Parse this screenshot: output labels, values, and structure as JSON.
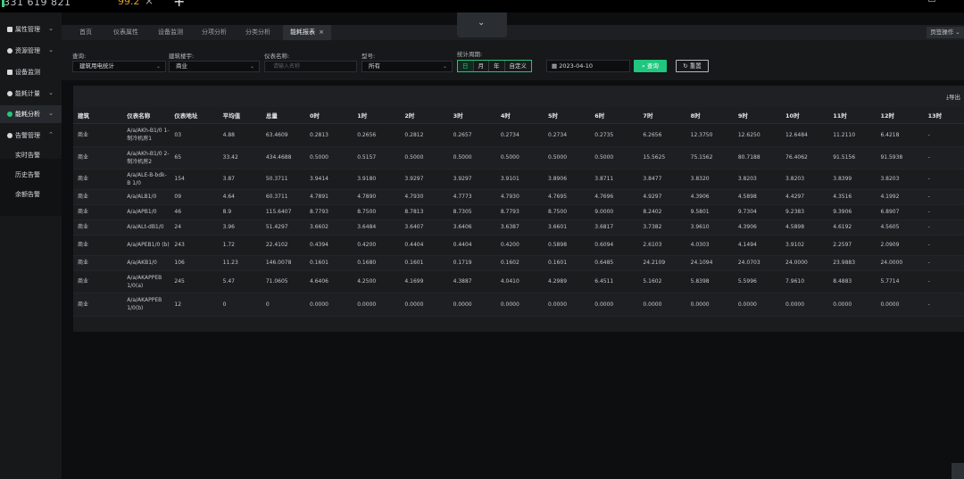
{
  "topbar": {
    "number": "331 619 821",
    "badge": "99.2",
    "close": "×",
    "plus": "+"
  },
  "sidebar": {
    "items": [
      {
        "label": "属性管理",
        "icon": "grid-icon",
        "chev": "⌄"
      },
      {
        "label": "资源管理",
        "icon": "gear-icon",
        "chev": "⌄"
      },
      {
        "label": "设备监测",
        "icon": "monitor-icon",
        "chev": ""
      },
      {
        "label": "能耗计量",
        "icon": "meter-icon",
        "chev": "⌄"
      },
      {
        "label": "能耗分析",
        "icon": "chart-icon",
        "chev": "⌄"
      },
      {
        "label": "告警管理",
        "icon": "bell-icon",
        "chev": "⌃"
      }
    ],
    "sub_items": [
      "实时告警",
      "历史告警",
      "余额告警"
    ]
  },
  "tabs": [
    {
      "label": "首页"
    },
    {
      "label": "仪表属性"
    },
    {
      "label": "设备监测"
    },
    {
      "label": "分项分析"
    },
    {
      "label": "分类分析"
    },
    {
      "label": "能耗报表"
    }
  ],
  "tab_close": "×",
  "tab_ops": "页签操作 ⌄",
  "collapse_icon": "⌄",
  "filters": {
    "query_label": "查询:",
    "query_value": "建筑用电统计",
    "building_label": "建筑楼宇:",
    "building_value": "商业",
    "meter_label": "仪表名称:",
    "meter_placeholder": "请输入名称",
    "model_label": "型号:",
    "model_value": "所有",
    "period_label": "统计周期:",
    "periods": [
      "日",
      "月",
      "年",
      "自定义"
    ],
    "date": "2023-04-10",
    "search_btn": "查询",
    "reset_btn": "重置",
    "arrow": "⌄"
  },
  "export_label": "导出",
  "table": {
    "columns": [
      "建筑",
      "仪表名称",
      "仪表地址",
      "平均值",
      "总量",
      "0时",
      "1时",
      "2时",
      "3时",
      "4时",
      "5时",
      "6时",
      "7时",
      "8时",
      "9时",
      "10时",
      "11时",
      "12时",
      "13时"
    ],
    "rows": [
      [
        "商业",
        "A/a/AKh-B1/0 1-制冷机房1",
        "03",
        "4.88",
        "63.4609",
        "0.2813",
        "0.2656",
        "0.2812",
        "0.2657",
        "0.2734",
        "0.2734",
        "0.2735",
        "6.2656",
        "12.3750",
        "12.6250",
        "12.6484",
        "11.2110",
        "6.4218",
        "-"
      ],
      [
        "商业",
        "A/a/AKh-B1/0 2-制冷机房2",
        "65",
        "33.42",
        "434.4688",
        "0.5000",
        "0.5157",
        "0.5000",
        "0.5000",
        "0.5000",
        "0.5000",
        "0.5000",
        "15.5625",
        "75.1562",
        "80.7188",
        "76.4062",
        "91.5156",
        "91.5938",
        "-"
      ],
      [
        "商业",
        "A/a/ALE-B-bdk-B 1/0",
        "154",
        "3.87",
        "50.3711",
        "3.9414",
        "3.9180",
        "3.9297",
        "3.9297",
        "3.9101",
        "3.8906",
        "3.8711",
        "3.8477",
        "3.8320",
        "3.8203",
        "3.8203",
        "3.8399",
        "3.8203",
        "-"
      ],
      [
        "商业",
        "A/a/ALB1/0",
        "09",
        "4.64",
        "60.3711",
        "4.7891",
        "4.7890",
        "4.7930",
        "4.7773",
        "4.7930",
        "4.7695",
        "4.7696",
        "4.9297",
        "4.3906",
        "4.5898",
        "4.4297",
        "4.3516",
        "4.1992",
        "-"
      ],
      [
        "商业",
        "A/a/APB1/0",
        "46",
        "8.9",
        "115.6407",
        "8.7793",
        "8.7500",
        "8.7813",
        "8.7305",
        "8.7793",
        "8.7500",
        "9.0000",
        "8.2402",
        "9.5801",
        "9.7304",
        "9.2383",
        "9.3906",
        "6.8907",
        "-"
      ],
      [
        "商业",
        "A/a/ALt-dB1/0",
        "24",
        "3.96",
        "51.4297",
        "3.6602",
        "3.6484",
        "3.6407",
        "3.6406",
        "3.6387",
        "3.6601",
        "3.6817",
        "3.7382",
        "3.9610",
        "4.3906",
        "4.5898",
        "4.6192",
        "4.5605",
        "-"
      ],
      [
        "商业",
        "A/a/APEB1/0 (b)",
        "243",
        "1.72",
        "22.4102",
        "0.4394",
        "0.4200",
        "0.4404",
        "0.4404",
        "0.4200",
        "0.5898",
        "0.6094",
        "2.6103",
        "4.0303",
        "4.1494",
        "3.9102",
        "2.2597",
        "2.0909",
        "-"
      ],
      [
        "商业",
        "A/a/AKB1/0",
        "106",
        "11.23",
        "146.0078",
        "0.1601",
        "0.1680",
        "0.1601",
        "0.1719",
        "0.1602",
        "0.1601",
        "0.6485",
        "24.2109",
        "24.1094",
        "24.0703",
        "24.0000",
        "23.9883",
        "24.0000",
        "-"
      ],
      [
        "商业",
        "A/a/AKAPPEB 1/0(a)",
        "245",
        "5.47",
        "71.0605",
        "4.6406",
        "4.2500",
        "4.1699",
        "4.3887",
        "4.0410",
        "4.2989",
        "6.4511",
        "5.1602",
        "5.8398",
        "5.5996",
        "7.9610",
        "8.4883",
        "5.7714",
        "-"
      ],
      [
        "商业",
        "A/a/AKAPPEB 1/0(b)",
        "12",
        "0",
        "0",
        "0.0000",
        "0.0000",
        "0.0000",
        "0.0000",
        "0.0000",
        "0.0000",
        "0.0000",
        "0.0000",
        "0.0000",
        "0.0000",
        "0.0000",
        "0.0000",
        "0.0000",
        "-"
      ]
    ]
  },
  "colors": {
    "accent": "#21c77e",
    "bg": "#0d0e10",
    "panel": "#1b1c1e"
  }
}
